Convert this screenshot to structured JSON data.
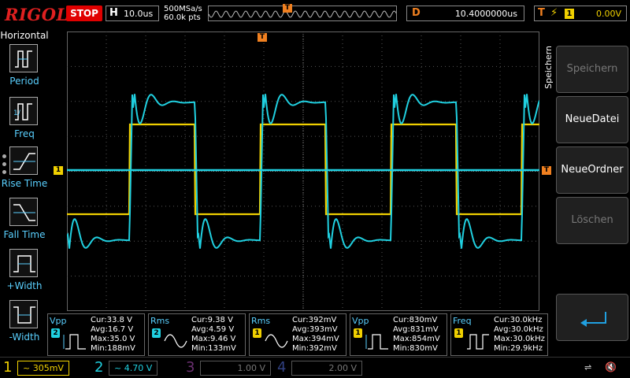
{
  "brand": "RIGOL",
  "run_state": "STOP",
  "horizontal": {
    "label": "H",
    "timebase": "10.0us"
  },
  "acquisition": {
    "sample_rate": "500MSa/s",
    "points": "60.0k pts"
  },
  "delay": {
    "label": "D",
    "value": "10.4000000us"
  },
  "trigger": {
    "label": "T",
    "source": "1",
    "level": "0.00V",
    "marker": "T"
  },
  "left_menu": {
    "title": "Horizontal",
    "items": [
      {
        "label": "Period"
      },
      {
        "label": "Freq"
      },
      {
        "label": "Rise Time"
      },
      {
        "label": "Fall Time"
      },
      {
        "label": "+Width"
      },
      {
        "label": "-Width"
      }
    ]
  },
  "right_menu": {
    "title": "Speichern",
    "buttons": [
      {
        "label": "Speichern",
        "enabled": false
      },
      {
        "label": "NeueDatei",
        "enabled": true
      },
      {
        "label": "NeueOrdner",
        "enabled": true
      },
      {
        "label": "Löschen",
        "enabled": false
      }
    ],
    "back_icon": "return-arrow-icon"
  },
  "measurements": [
    {
      "name": "Vpp",
      "channel": "2",
      "cur": "Cur:33.8 V",
      "avg": "Avg:16.7 V",
      "max": "Max:35.0 V",
      "min": "Min:188mV"
    },
    {
      "name": "Rms",
      "channel": "2",
      "cur": "Cur:9.38 V",
      "avg": "Avg:4.59 V",
      "max": "Max:9.46 V",
      "min": "Min:133mV"
    },
    {
      "name": "Rms",
      "channel": "1",
      "cur": "Cur:392mV",
      "avg": "Avg:393mV",
      "max": "Max:394mV",
      "min": "Min:392mV"
    },
    {
      "name": "Vpp",
      "channel": "1",
      "cur": "Cur:830mV",
      "avg": "Avg:831mV",
      "max": "Max:854mV",
      "min": "Min:830mV"
    },
    {
      "name": "Freq",
      "channel": "1",
      "cur": "Cur:30.0kHz",
      "avg": "Avg:30.0kHz",
      "max": "Max:30.0kHz",
      "min": "Min:29.9kHz"
    }
  ],
  "channels": [
    {
      "num": "1",
      "scale": "~ 305mV",
      "color": "#f0d000",
      "active": true
    },
    {
      "num": "2",
      "scale": "~ 4.70 V",
      "color": "#20d0e0",
      "active": true
    },
    {
      "num": "3",
      "scale": "1.00 V",
      "color": "#c040c0",
      "active": false
    },
    {
      "num": "4",
      "scale": "2.00 V",
      "color": "#4060ff",
      "active": false
    }
  ],
  "markers": {
    "ch1": "1"
  },
  "colors": {
    "ch1": "#f0d000",
    "ch2": "#20d0e0",
    "trigger": "#f08020",
    "grid": "#555555"
  }
}
